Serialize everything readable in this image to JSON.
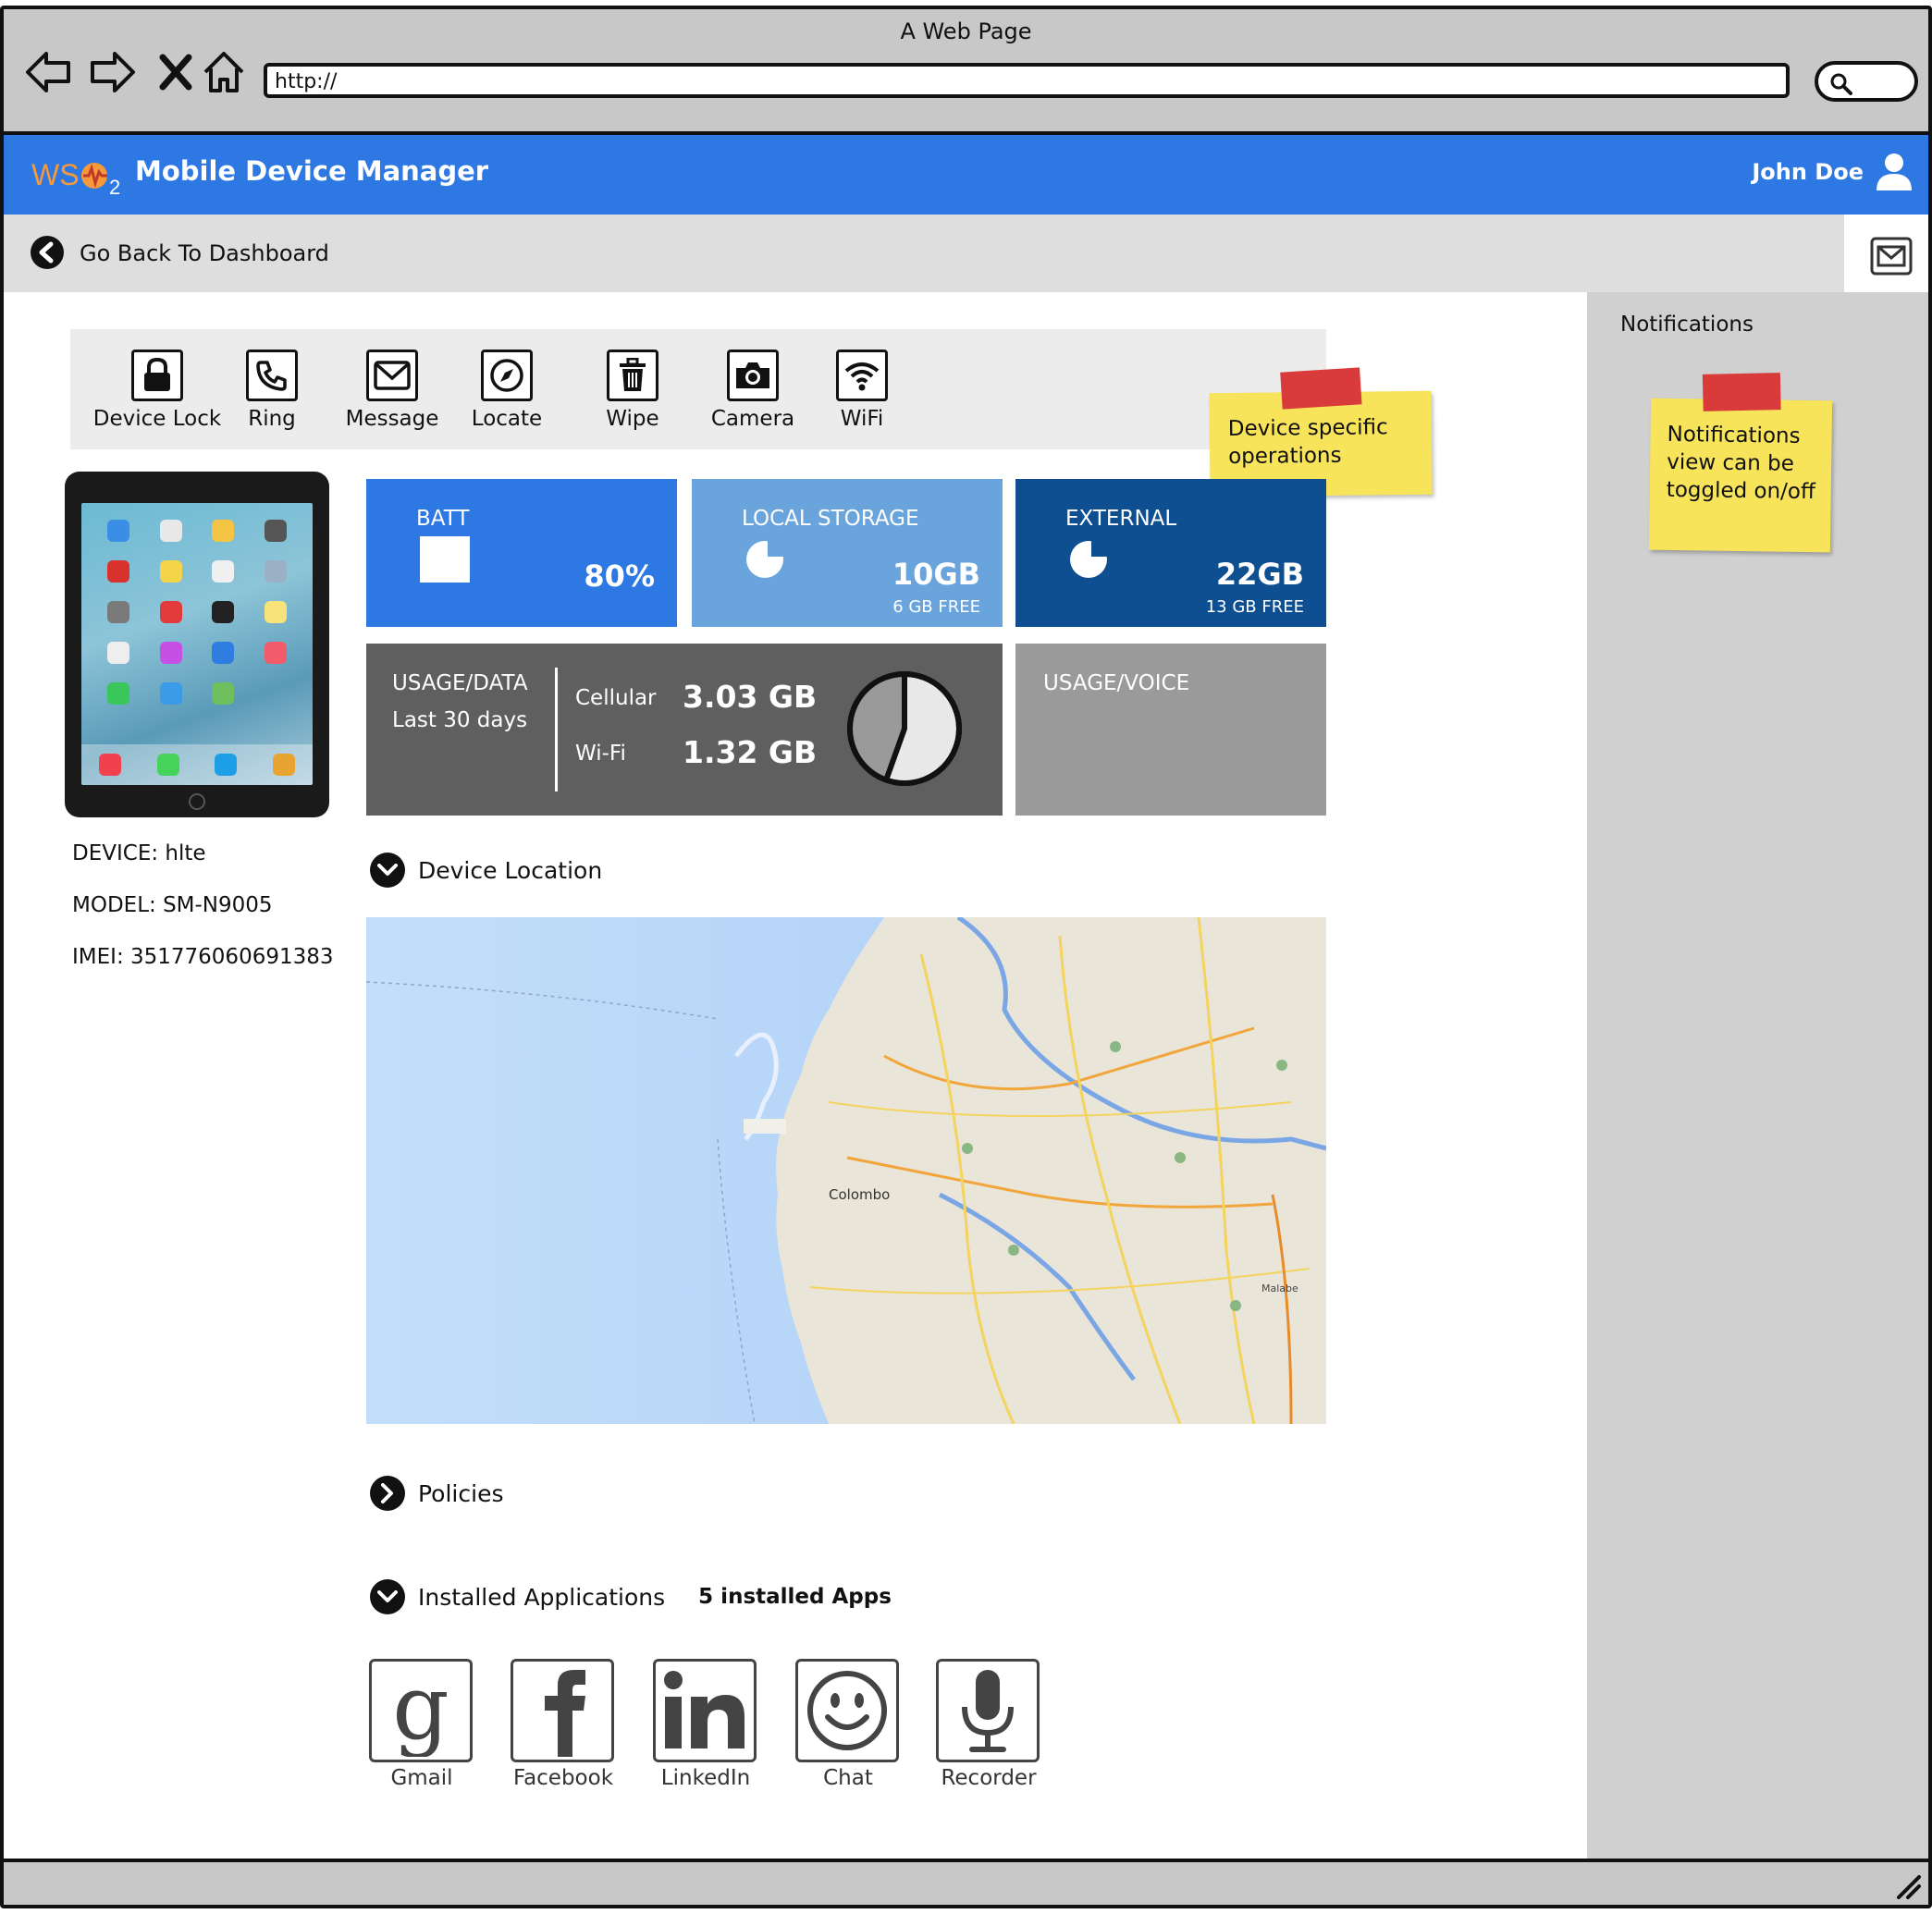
{
  "browser": {
    "title": "A Web Page",
    "url": "http://",
    "nav_icons": [
      "back-arrow-icon",
      "forward-arrow-icon",
      "stop-icon",
      "home-icon"
    ],
    "search_icon": "search-icon"
  },
  "header": {
    "logo_text": "WSO2",
    "title": "Mobile Device Manager",
    "user_name": "John Doe",
    "bg_color": "#2d78e3"
  },
  "breadcrumb": {
    "back_label": "Go Back To Dashboard"
  },
  "operations": [
    {
      "label": "Device Lock",
      "icon": "lock-icon"
    },
    {
      "label": "Ring",
      "icon": "phone-icon"
    },
    {
      "label": "Message",
      "icon": "envelope-icon"
    },
    {
      "label": "Locate",
      "icon": "compass-icon"
    },
    {
      "label": "Wipe",
      "icon": "trash-icon"
    },
    {
      "label": "Camera",
      "icon": "camera-icon"
    },
    {
      "label": "WiFi",
      "icon": "wifi-icon"
    }
  ],
  "notes": {
    "device_ops": "Device specific operations",
    "notifications": "Notifications view can be toggled on/off"
  },
  "notifications": {
    "title": "Notifications"
  },
  "device": {
    "device_line": "DEVICE: hlte",
    "model_line": "MODEL: SM-N9005",
    "imei_line": "IMEI: 351776060691383"
  },
  "tiles": {
    "battery": {
      "label": "BATT",
      "value": "80%",
      "color": "#2d78e3"
    },
    "local_storage": {
      "label": "LOCAL STORAGE",
      "value": "10GB",
      "free": "6 GB FREE",
      "color": "#6aa4dc"
    },
    "external": {
      "label": "EXTERNAL",
      "value": "22GB",
      "free": "13 GB FREE",
      "color": "#0d4f91"
    },
    "usage_data": {
      "label": "USAGE/DATA",
      "period": "Last 30 days",
      "cellular_label": "Cellular",
      "cellular_value": "3.03 GB",
      "wifi_label": "Wi-Fi",
      "wifi_value": "1.32 GB",
      "color": "#5f5f5f"
    },
    "usage_voice": {
      "label": "USAGE/VOICE",
      "color": "#9a9a9a"
    }
  },
  "sections": {
    "location": "Device Location",
    "policies": "Policies",
    "installed": "Installed Applications",
    "installed_count": "5 installed Apps"
  },
  "map": {
    "city_label": "Colombo",
    "place_label": "Malabe"
  },
  "apps": [
    {
      "name": "Gmail",
      "icon": "google-icon"
    },
    {
      "name": "Facebook",
      "icon": "facebook-icon"
    },
    {
      "name": "LinkedIn",
      "icon": "linkedin-icon"
    },
    {
      "name": "Chat",
      "icon": "smiley-icon"
    },
    {
      "name": "Recorder",
      "icon": "microphone-icon"
    }
  ]
}
